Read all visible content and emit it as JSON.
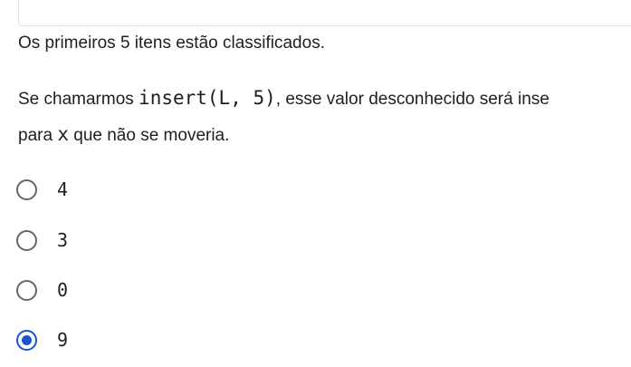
{
  "intro": {
    "sorted_note": "Os primeiros 5 itens estão classificados."
  },
  "question": {
    "prefix": "Se chamarmos ",
    "call": "insert(L, 5)",
    "suffix": ", esse valor desconhecido será inse",
    "line2_prefix": "para ",
    "var": "x",
    "line2_suffix": " que não se moveria."
  },
  "options": [
    {
      "label": "4",
      "selected": false
    },
    {
      "label": "3",
      "selected": false
    },
    {
      "label": "0",
      "selected": false
    },
    {
      "label": "9",
      "selected": true
    }
  ],
  "colors": {
    "accent": "#1a56c9",
    "radio_border": "#666666",
    "text": "#1f1f1f"
  }
}
